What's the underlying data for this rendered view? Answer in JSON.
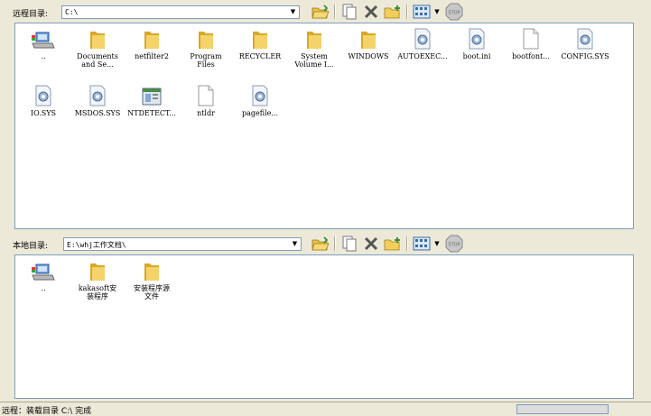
{
  "remote": {
    "label": "远程目录:",
    "path": "C:\\",
    "items": [
      {
        "name": "..",
        "type": "up"
      },
      {
        "name": "Documents\nand Se...",
        "type": "folder"
      },
      {
        "name": "netfilter2",
        "type": "folder"
      },
      {
        "name": "Program\nFiles",
        "type": "folder"
      },
      {
        "name": "RECYCLER",
        "type": "folder"
      },
      {
        "name": "System\nVolume I...",
        "type": "folder"
      },
      {
        "name": "WINDOWS",
        "type": "folder"
      },
      {
        "name": "AUTOEXEC...",
        "type": "settings"
      },
      {
        "name": "boot.ini",
        "type": "settings"
      },
      {
        "name": "bootfont...",
        "type": "file"
      },
      {
        "name": "CONFIG.SYS",
        "type": "settings"
      },
      {
        "name": "IO.SYS",
        "type": "settings"
      },
      {
        "name": "MSDOS.SYS",
        "type": "settings"
      },
      {
        "name": "NTDETECT...",
        "type": "app"
      },
      {
        "name": "ntldr",
        "type": "file"
      },
      {
        "name": "pagefile...",
        "type": "settings"
      }
    ]
  },
  "local": {
    "label": "本地目录:",
    "path": "E:\\whj工作文档\\",
    "items": [
      {
        "name": "..",
        "type": "up"
      },
      {
        "name": "kakasoft安\n装程序",
        "type": "folder"
      },
      {
        "name": "安装程序源\n文件",
        "type": "folder"
      }
    ]
  },
  "status": {
    "text": "远程：装载目录 C:\\ 完成"
  },
  "colors": {
    "folder": "#f4d36b",
    "folder_dark": "#d9a82a",
    "accent": "#3a6ea5"
  }
}
